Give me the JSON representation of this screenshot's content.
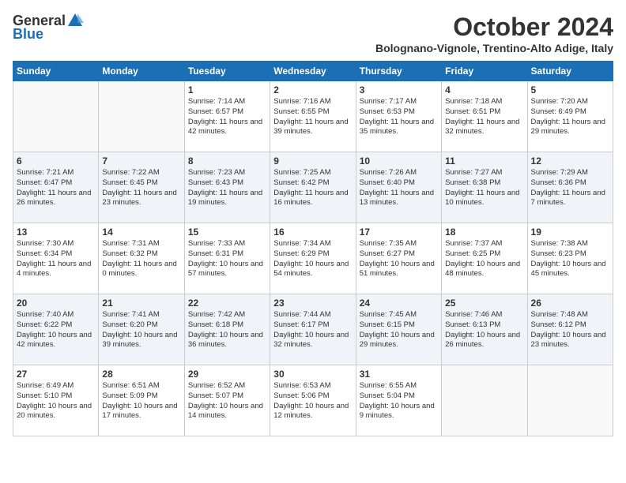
{
  "header": {
    "logo_general": "General",
    "logo_blue": "Blue",
    "month": "October 2024",
    "location": "Bolognano-Vignole, Trentino-Alto Adige, Italy"
  },
  "weekdays": [
    "Sunday",
    "Monday",
    "Tuesday",
    "Wednesday",
    "Thursday",
    "Friday",
    "Saturday"
  ],
  "weeks": [
    [
      {
        "day": "",
        "info": ""
      },
      {
        "day": "",
        "info": ""
      },
      {
        "day": "1",
        "info": "Sunrise: 7:14 AM\nSunset: 6:57 PM\nDaylight: 11 hours and 42 minutes."
      },
      {
        "day": "2",
        "info": "Sunrise: 7:16 AM\nSunset: 6:55 PM\nDaylight: 11 hours and 39 minutes."
      },
      {
        "day": "3",
        "info": "Sunrise: 7:17 AM\nSunset: 6:53 PM\nDaylight: 11 hours and 35 minutes."
      },
      {
        "day": "4",
        "info": "Sunrise: 7:18 AM\nSunset: 6:51 PM\nDaylight: 11 hours and 32 minutes."
      },
      {
        "day": "5",
        "info": "Sunrise: 7:20 AM\nSunset: 6:49 PM\nDaylight: 11 hours and 29 minutes."
      }
    ],
    [
      {
        "day": "6",
        "info": "Sunrise: 7:21 AM\nSunset: 6:47 PM\nDaylight: 11 hours and 26 minutes."
      },
      {
        "day": "7",
        "info": "Sunrise: 7:22 AM\nSunset: 6:45 PM\nDaylight: 11 hours and 23 minutes."
      },
      {
        "day": "8",
        "info": "Sunrise: 7:23 AM\nSunset: 6:43 PM\nDaylight: 11 hours and 19 minutes."
      },
      {
        "day": "9",
        "info": "Sunrise: 7:25 AM\nSunset: 6:42 PM\nDaylight: 11 hours and 16 minutes."
      },
      {
        "day": "10",
        "info": "Sunrise: 7:26 AM\nSunset: 6:40 PM\nDaylight: 11 hours and 13 minutes."
      },
      {
        "day": "11",
        "info": "Sunrise: 7:27 AM\nSunset: 6:38 PM\nDaylight: 11 hours and 10 minutes."
      },
      {
        "day": "12",
        "info": "Sunrise: 7:29 AM\nSunset: 6:36 PM\nDaylight: 11 hours and 7 minutes."
      }
    ],
    [
      {
        "day": "13",
        "info": "Sunrise: 7:30 AM\nSunset: 6:34 PM\nDaylight: 11 hours and 4 minutes."
      },
      {
        "day": "14",
        "info": "Sunrise: 7:31 AM\nSunset: 6:32 PM\nDaylight: 11 hours and 0 minutes."
      },
      {
        "day": "15",
        "info": "Sunrise: 7:33 AM\nSunset: 6:31 PM\nDaylight: 10 hours and 57 minutes."
      },
      {
        "day": "16",
        "info": "Sunrise: 7:34 AM\nSunset: 6:29 PM\nDaylight: 10 hours and 54 minutes."
      },
      {
        "day": "17",
        "info": "Sunrise: 7:35 AM\nSunset: 6:27 PM\nDaylight: 10 hours and 51 minutes."
      },
      {
        "day": "18",
        "info": "Sunrise: 7:37 AM\nSunset: 6:25 PM\nDaylight: 10 hours and 48 minutes."
      },
      {
        "day": "19",
        "info": "Sunrise: 7:38 AM\nSunset: 6:23 PM\nDaylight: 10 hours and 45 minutes."
      }
    ],
    [
      {
        "day": "20",
        "info": "Sunrise: 7:40 AM\nSunset: 6:22 PM\nDaylight: 10 hours and 42 minutes."
      },
      {
        "day": "21",
        "info": "Sunrise: 7:41 AM\nSunset: 6:20 PM\nDaylight: 10 hours and 39 minutes."
      },
      {
        "day": "22",
        "info": "Sunrise: 7:42 AM\nSunset: 6:18 PM\nDaylight: 10 hours and 36 minutes."
      },
      {
        "day": "23",
        "info": "Sunrise: 7:44 AM\nSunset: 6:17 PM\nDaylight: 10 hours and 32 minutes."
      },
      {
        "day": "24",
        "info": "Sunrise: 7:45 AM\nSunset: 6:15 PM\nDaylight: 10 hours and 29 minutes."
      },
      {
        "day": "25",
        "info": "Sunrise: 7:46 AM\nSunset: 6:13 PM\nDaylight: 10 hours and 26 minutes."
      },
      {
        "day": "26",
        "info": "Sunrise: 7:48 AM\nSunset: 6:12 PM\nDaylight: 10 hours and 23 minutes."
      }
    ],
    [
      {
        "day": "27",
        "info": "Sunrise: 6:49 AM\nSunset: 5:10 PM\nDaylight: 10 hours and 20 minutes."
      },
      {
        "day": "28",
        "info": "Sunrise: 6:51 AM\nSunset: 5:09 PM\nDaylight: 10 hours and 17 minutes."
      },
      {
        "day": "29",
        "info": "Sunrise: 6:52 AM\nSunset: 5:07 PM\nDaylight: 10 hours and 14 minutes."
      },
      {
        "day": "30",
        "info": "Sunrise: 6:53 AM\nSunset: 5:06 PM\nDaylight: 10 hours and 12 minutes."
      },
      {
        "day": "31",
        "info": "Sunrise: 6:55 AM\nSunset: 5:04 PM\nDaylight: 10 hours and 9 minutes."
      },
      {
        "day": "",
        "info": ""
      },
      {
        "day": "",
        "info": ""
      }
    ]
  ]
}
